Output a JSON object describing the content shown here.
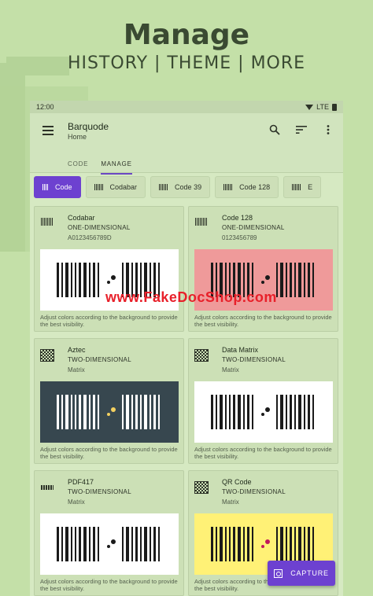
{
  "promo": {
    "title": "Manage",
    "subtitle": "HISTORY | THEME | MORE"
  },
  "status_bar": {
    "time": "12:00",
    "network": "LTE"
  },
  "app_bar": {
    "title": "Barquode",
    "subtitle": "Home",
    "icons": [
      "menu-icon",
      "search-icon",
      "sort-icon",
      "more-vert-icon"
    ]
  },
  "tabs": [
    {
      "label": "CODE",
      "active": false
    },
    {
      "label": "MANAGE",
      "active": true
    }
  ],
  "chips": [
    {
      "label": "Code",
      "selected": true
    },
    {
      "label": "Codabar",
      "selected": false
    },
    {
      "label": "Code 39",
      "selected": false
    },
    {
      "label": "Code 128",
      "selected": false
    },
    {
      "label": "E",
      "selected": false
    }
  ],
  "cards": [
    {
      "name": "Codabar",
      "type": "ONE-DIMENSIONAL",
      "value": "A0123456789D",
      "icon": "barcode-1d-icon",
      "bg": "#ffffff",
      "bar": "#1a1a1a",
      "dot": "#1a1a1a",
      "hint": "Adjust colors according to the background to provide the best visibility."
    },
    {
      "name": "Code 128",
      "type": "ONE-DIMENSIONAL",
      "value": "0123456789",
      "icon": "barcode-1d-icon",
      "bg": "#ef9a9a",
      "bar": "#1a1a1a",
      "dot": "#1a1a1a",
      "hint": "Adjust colors according to the background to provide the best visibility."
    },
    {
      "name": "Aztec",
      "type": "TWO-DIMENSIONAL",
      "value": "Matrix",
      "icon": "qr-2d-icon",
      "bg": "#37474f",
      "bar": "#ffffff",
      "dot": "#f4d160",
      "hint": "Adjust colors according to the background to provide the best visibility."
    },
    {
      "name": "Data Matrix",
      "type": "TWO-DIMENSIONAL",
      "value": "Matrix",
      "icon": "qr-2d-icon",
      "bg": "#ffffff",
      "bar": "#1a1a1a",
      "dot": "#1a1a1a",
      "hint": "Adjust colors according to the background to provide the best visibility."
    },
    {
      "name": "PDF417",
      "type": "TWO-DIMENSIONAL",
      "value": "Matrix",
      "icon": "pdf417-icon",
      "bg": "#ffffff",
      "bar": "#1a1a1a",
      "dot": "#1a1a1a",
      "hint": "Adjust colors according to the background to provide the best visibility."
    },
    {
      "name": "QR Code",
      "type": "TWO-DIMENSIONAL",
      "value": "Matrix",
      "icon": "qr-2d-icon",
      "bg": "#fff176",
      "bar": "#1a1a1a",
      "dot": "#c2185b",
      "hint": "Adjust colors according to the background to provide the best visibility."
    }
  ],
  "capture_button": {
    "label": "CAPTURE"
  },
  "watermark": "www.FakeDocShop.com",
  "colors": {
    "background": "#c4e0a8",
    "accent": "#6d41d0"
  }
}
